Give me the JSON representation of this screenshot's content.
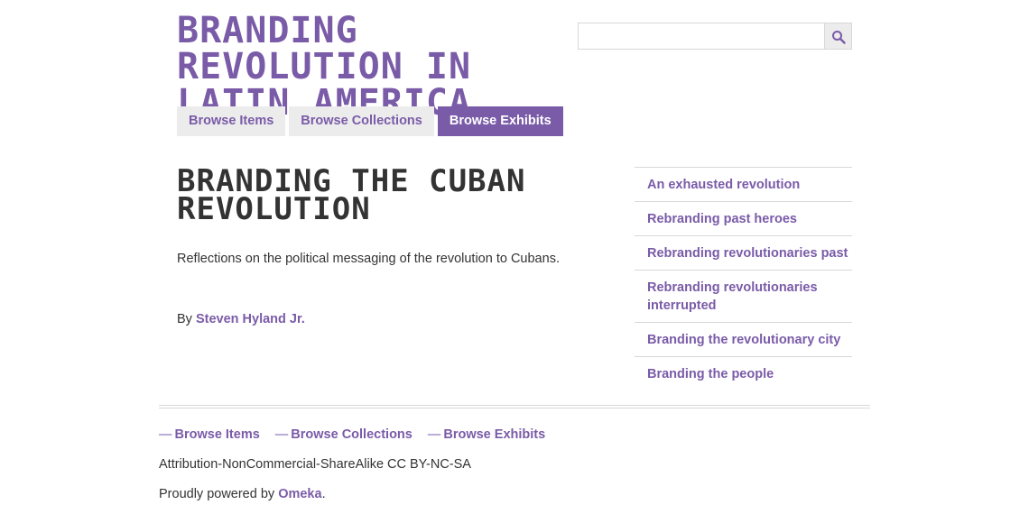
{
  "site": {
    "title": "Branding Revolution in Latin America"
  },
  "search": {
    "placeholder": "",
    "icon": "search-icon"
  },
  "nav": {
    "items": [
      {
        "label": "Browse Items"
      },
      {
        "label": "Browse Collections"
      },
      {
        "label": "Browse Exhibits",
        "active": true
      }
    ]
  },
  "exhibit": {
    "title": "Branding the Cuban Revolution",
    "description": "Reflections on the political messaging of the revolution to Cubans.",
    "by_label": "By",
    "author": "Steven Hyland Jr."
  },
  "toc": {
    "items": [
      {
        "label": "An exhausted revolution"
      },
      {
        "label": "Rebranding past heroes"
      },
      {
        "label": "Rebranding revolutionaries past"
      },
      {
        "label": "Rebranding revolutionaries interrupted"
      },
      {
        "label": "Branding the revolutionary city"
      },
      {
        "label": "Branding the people"
      }
    ]
  },
  "footer": {
    "dash": "—",
    "nav": [
      {
        "label": "Browse Items"
      },
      {
        "label": "Browse Collections"
      },
      {
        "label": "Browse Exhibits"
      }
    ],
    "license": "Attribution-NonCommercial-ShareAlike CC BY-NC-SA",
    "powered_prefix": "Proudly powered by ",
    "powered_link": "Omeka",
    "powered_suffix": "."
  },
  "colors": {
    "accent": "#7a5ba8",
    "text": "#333333",
    "tab_bg": "#ececec",
    "rule": "#d8d8d8"
  }
}
